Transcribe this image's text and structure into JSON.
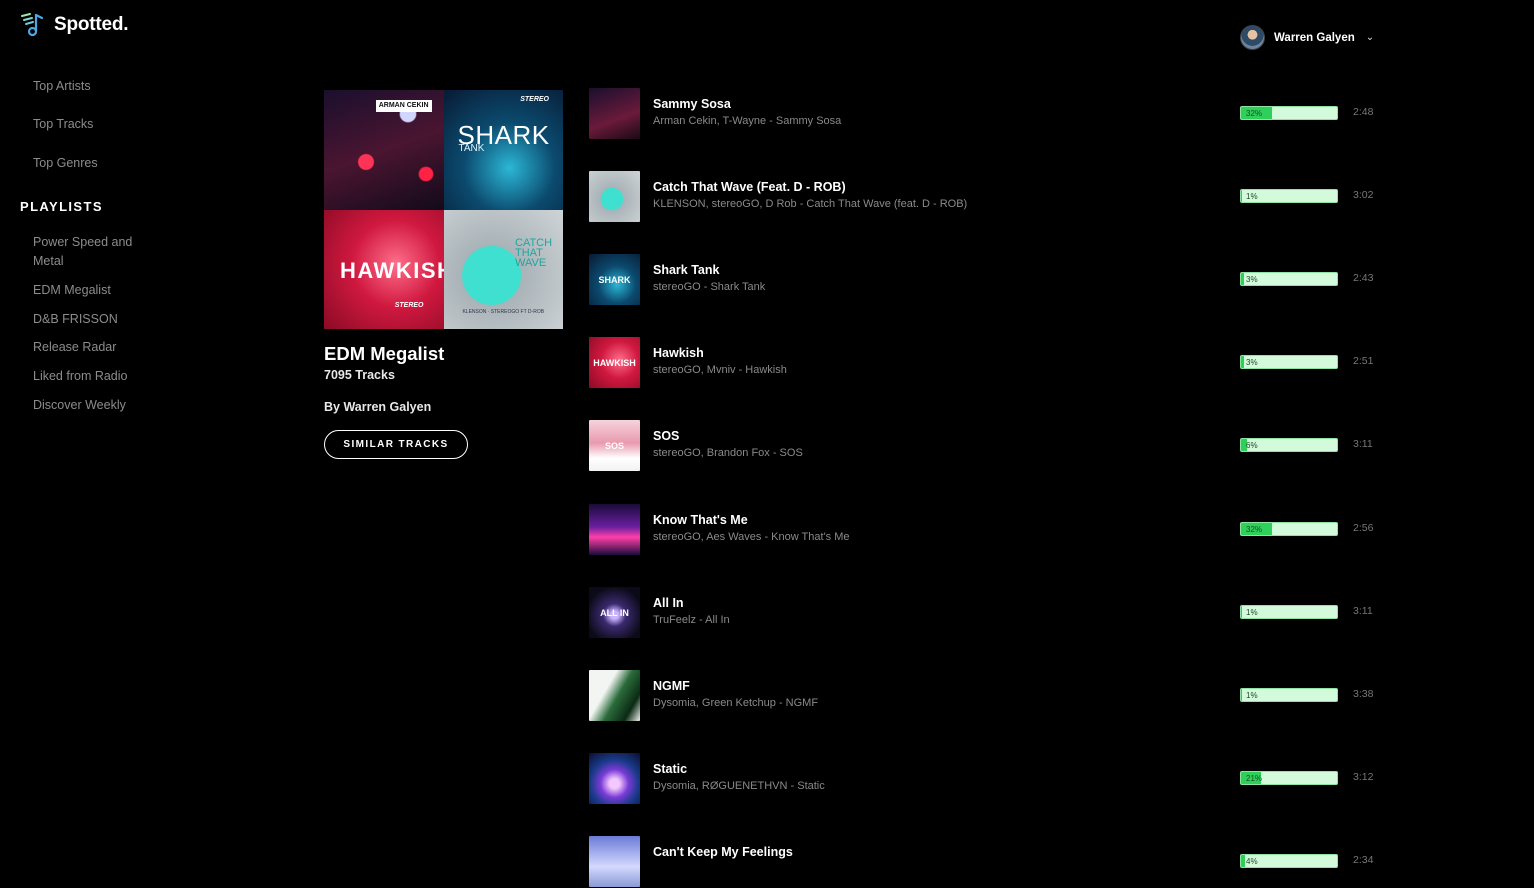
{
  "app": {
    "name": "Spotted."
  },
  "colors": {
    "accent": "#2fd05a",
    "bar_bg": "#d4fadc",
    "muted_text": "#8c8c8c",
    "background": "#000000"
  },
  "sidebar": {
    "nav": [
      {
        "label": "Top Artists"
      },
      {
        "label": "Top Tracks"
      },
      {
        "label": "Top Genres"
      }
    ],
    "playlists_heading": "PLAYLISTS",
    "playlists": [
      {
        "label": "Power Speed and Metal"
      },
      {
        "label": "EDM Megalist"
      },
      {
        "label": "D&B FRISSON"
      },
      {
        "label": "Release Radar"
      },
      {
        "label": "Liked from Radio"
      },
      {
        "label": "Discover Weekly"
      }
    ]
  },
  "user": {
    "name": "Warren Galyen",
    "menu_icon": "chevron-down-icon"
  },
  "playlist": {
    "title": "EDM Megalist",
    "track_count": "7095 Tracks",
    "owner": "By Warren Galyen",
    "button_label": "SIMILAR TRACKS",
    "cover": {
      "tile1_label": "ARMAN CEKIN",
      "tile2_big": "SHARK",
      "tile2_small": "TANK",
      "tile2_brand": "STEREO",
      "tile3_big": "HAWKISH",
      "tile3_brand": "STEREO",
      "tile4_big": "CATCH THAT WAVE",
      "tile4_foot": "KLENSON · STEREOGO FT D-ROB"
    }
  },
  "tracks": [
    {
      "title": "Sammy Sosa",
      "artists": "Arman Cekin, T-Wayne - Sammy Sosa",
      "popularity": 32,
      "popularity_label": "32%",
      "duration": "2:48"
    },
    {
      "title": "Catch That Wave (Feat. D - ROB)",
      "artists": "KLENSON, stereoGO, D Rob - Catch That Wave (feat. D - ROB)",
      "popularity": 1,
      "popularity_label": "1%",
      "duration": "3:02"
    },
    {
      "title": "Shark Tank",
      "artists": "stereoGO - Shark Tank",
      "popularity": 3,
      "popularity_label": "3%",
      "duration": "2:43"
    },
    {
      "title": "Hawkish",
      "artists": "stereoGO, Mvniv - Hawkish",
      "popularity": 3,
      "popularity_label": "3%",
      "duration": "2:51"
    },
    {
      "title": "SOS",
      "artists": "stereoGO, Brandon Fox - SOS",
      "popularity": 6,
      "popularity_label": "6%",
      "duration": "3:11"
    },
    {
      "title": "Know That's Me",
      "artists": "stereoGO, Aes Waves - Know That's Me",
      "popularity": 32,
      "popularity_label": "32%",
      "duration": "2:56"
    },
    {
      "title": "All In",
      "artists": "TruFeelz - All In",
      "popularity": 1,
      "popularity_label": "1%",
      "duration": "3:11"
    },
    {
      "title": "NGMF",
      "artists": "Dysomia, Green Ketchup - NGMF",
      "popularity": 1,
      "popularity_label": "1%",
      "duration": "3:38"
    },
    {
      "title": "Static",
      "artists": "Dysomia, RØGUENETHVN - Static",
      "popularity": 21,
      "popularity_label": "21%",
      "duration": "3:12"
    },
    {
      "title": "Can't Keep My Feelings",
      "artists": "",
      "popularity": 4,
      "popularity_label": "4%",
      "duration": "2:34"
    }
  ]
}
